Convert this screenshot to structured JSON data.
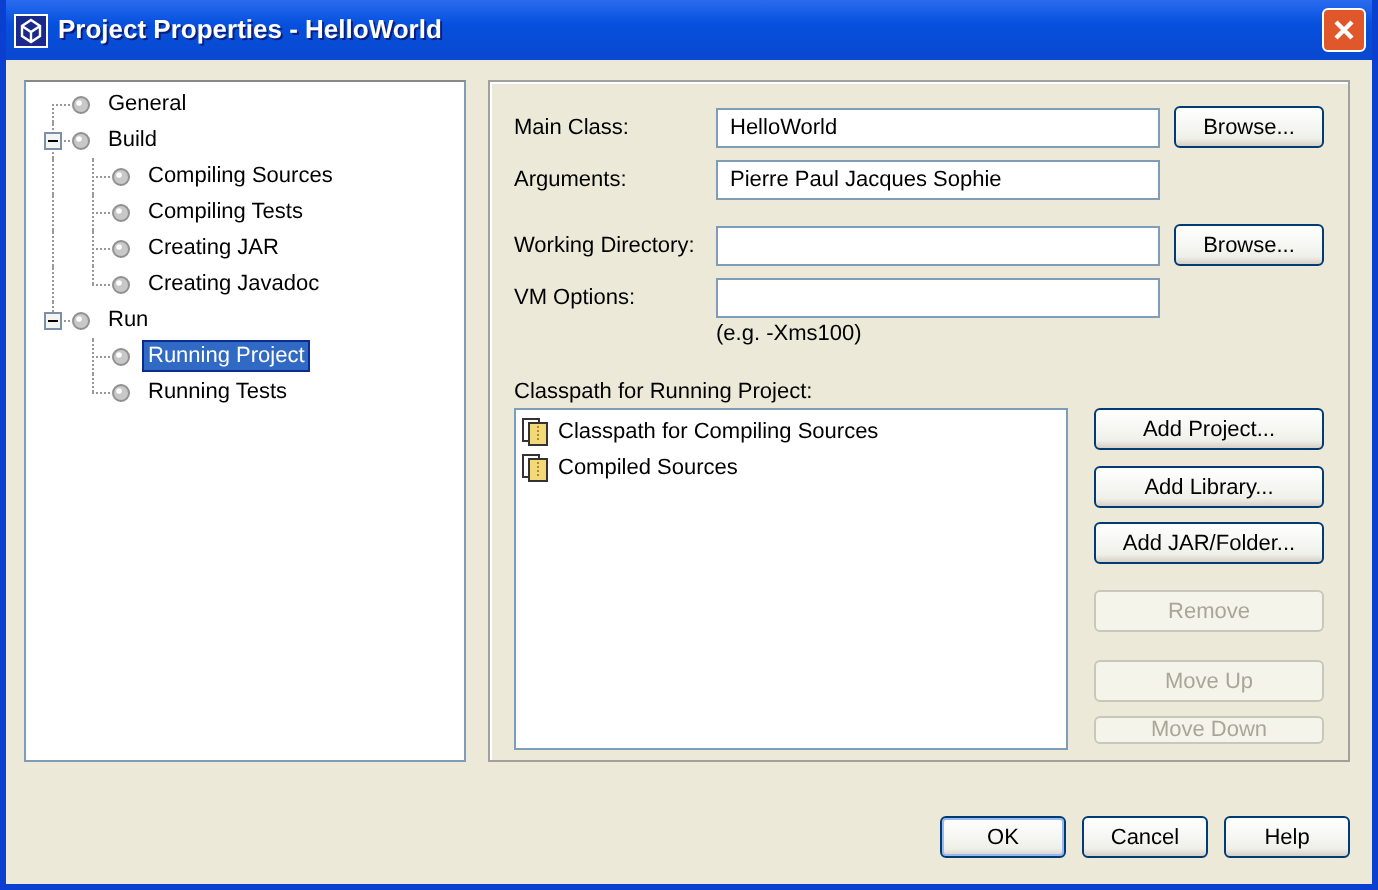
{
  "window": {
    "title": "Project Properties - HelloWorld"
  },
  "tree": [
    {
      "label": "General",
      "selected": false
    },
    {
      "label": "Build",
      "selected": false,
      "expanded": true,
      "children": [
        {
          "label": "Compiling Sources",
          "selected": false
        },
        {
          "label": "Compiling Tests",
          "selected": false
        },
        {
          "label": "Creating JAR",
          "selected": false
        },
        {
          "label": "Creating Javadoc",
          "selected": false
        }
      ]
    },
    {
      "label": "Run",
      "selected": false,
      "expanded": true,
      "children": [
        {
          "label": "Running Project",
          "selected": true
        },
        {
          "label": "Running Tests",
          "selected": false
        }
      ]
    }
  ],
  "form": {
    "fields": [
      {
        "label": "Main Class:",
        "value": "HelloWorld",
        "browse": "Browse..."
      },
      {
        "label": "Arguments:",
        "value": "Pierre Paul Jacques Sophie"
      },
      {
        "label": "Working Directory:",
        "browse": "Browse..."
      },
      {
        "label": "VM Options:",
        "hint": "(e.g. -Xms100)"
      }
    ],
    "classpath": {
      "label": "Classpath for Running Project:",
      "items": [
        "Classpath for Compiling Sources",
        "Compiled Sources"
      ],
      "buttons": [
        {
          "label": "Add Project...",
          "disabled": false
        },
        {
          "label": "Add Library...",
          "disabled": false
        },
        {
          "label": "Add JAR/Folder...",
          "disabled": false
        },
        {
          "label": "Remove",
          "disabled": true
        },
        {
          "label": "Move Up",
          "disabled": true
        },
        {
          "label": "Move Down",
          "disabled": true
        }
      ]
    }
  },
  "buttons": [
    {
      "label": "OK",
      "default": true
    },
    {
      "label": "Cancel",
      "default": false
    },
    {
      "label": "Help",
      "default": false
    }
  ]
}
